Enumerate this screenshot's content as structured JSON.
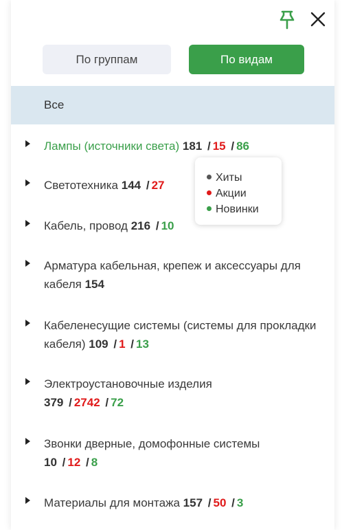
{
  "colors": {
    "accent": "#3a9f4a",
    "red": "#e01a1a",
    "selected_row": "#dae7f0",
    "inactive_tab": "#eef0f6"
  },
  "icons": {
    "pin": "pin-icon",
    "close": "close-icon"
  },
  "toggles": {
    "groups_label": "По группам",
    "kinds_label": "По видам",
    "active": "kinds"
  },
  "all_label": "Все",
  "categories": [
    {
      "name": "Лампы (источники света)",
      "count": "181",
      "promo": "15",
      "new": "86"
    },
    {
      "name": "Светотехника",
      "count": "144",
      "promo": "27"
    },
    {
      "name": "Кабель, провод",
      "count": "216",
      "new": "10"
    },
    {
      "name": "Арматура кабельная, крепеж и аксессуары для кабеля",
      "count": "154"
    },
    {
      "name": "Кабеленесущие системы (системы для прокладки кабеля)",
      "count": "109",
      "promo": "1",
      "new": "13"
    },
    {
      "name": "Электроустановочные изделия",
      "count": "379",
      "promo": "2742",
      "new": "72"
    },
    {
      "name": "Звонки дверные, домофонные системы",
      "count": "10",
      "promo": "12",
      "new": "8"
    },
    {
      "name": "Материалы для монтажа",
      "count": "157",
      "promo": "50",
      "new": "3"
    }
  ],
  "legend": {
    "hits": {
      "label": "Хиты",
      "color": "#555555"
    },
    "promo": {
      "label": "Акции",
      "color": "#e01a1a"
    },
    "new": {
      "label": "Новинки",
      "color": "#3a9f4a"
    }
  }
}
